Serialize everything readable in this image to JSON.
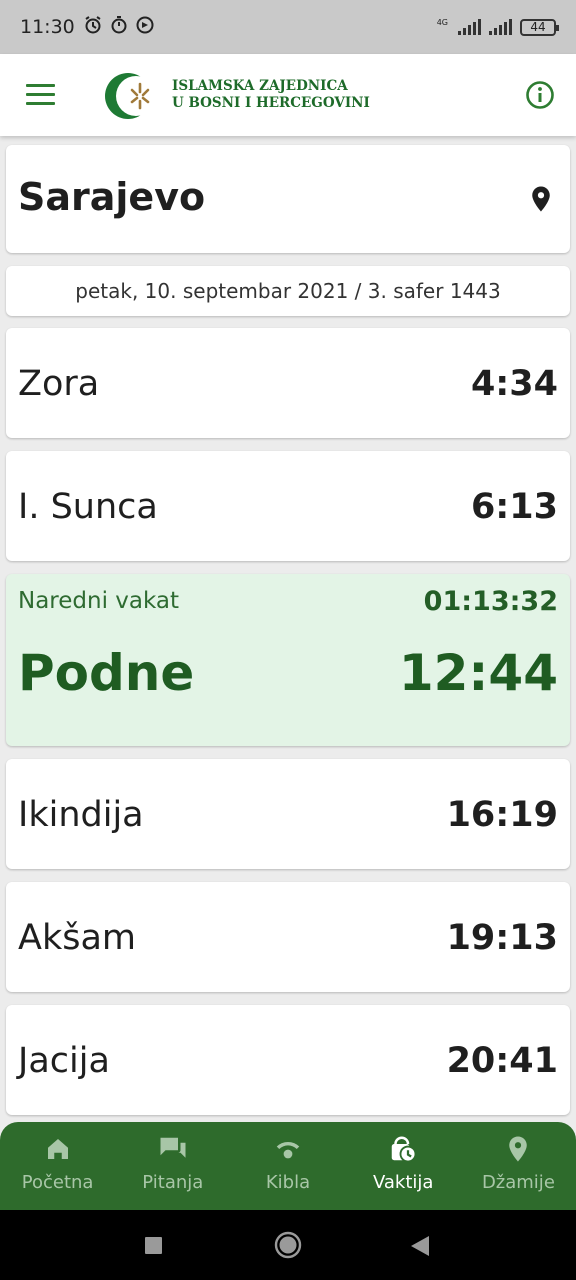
{
  "status_bar": {
    "time": "11:30",
    "net_type": "4G",
    "battery": "44"
  },
  "header": {
    "org_line1": "ISLAMSKA ZAJEDNICA",
    "org_line2": "U BOSNI I HERCEGOVINI"
  },
  "location": {
    "city": "Sarajevo"
  },
  "date": {
    "text": "petak, 10. septembar 2021 / 3. safer 1443"
  },
  "prayers": [
    {
      "name": "Zora",
      "time": "4:34"
    },
    {
      "name": "I. Sunca",
      "time": "6:13"
    },
    {
      "name": "Ikindija",
      "time": "16:19"
    },
    {
      "name": "Akšam",
      "time": "19:13"
    },
    {
      "name": "Jacija",
      "time": "20:41"
    }
  ],
  "next_prayer": {
    "label": "Naredni vakat",
    "countdown": "01:13:32",
    "name": "Podne",
    "time": "12:44"
  },
  "bottom_nav": [
    {
      "label": "Početna",
      "icon": "home-icon"
    },
    {
      "label": "Pitanja",
      "icon": "chat-icon"
    },
    {
      "label": "Kibla",
      "icon": "qibla-icon"
    },
    {
      "label": "Vaktija",
      "icon": "vaktija-icon",
      "active": true
    },
    {
      "label": "Džamije",
      "icon": "location-pin-icon"
    }
  ],
  "colors": {
    "brand_green": "#2e6b2c",
    "highlight_bg": "#e3f4e6",
    "icon_green": "#2e7d32"
  }
}
